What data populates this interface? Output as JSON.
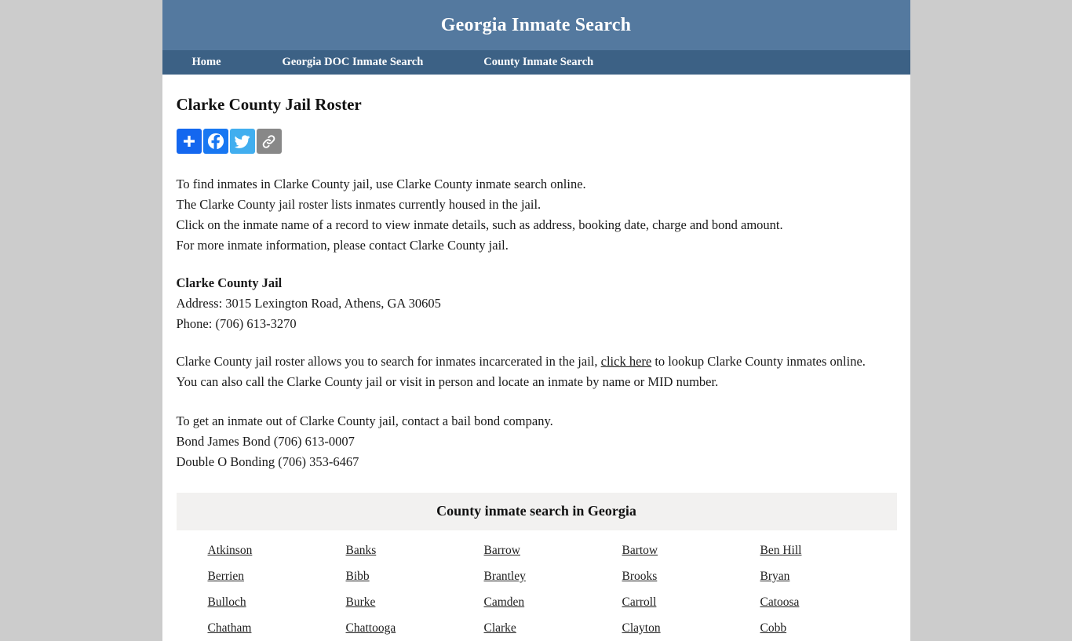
{
  "header": {
    "site_title": "Georgia Inmate Search"
  },
  "nav": {
    "items": [
      {
        "label": "Home"
      },
      {
        "label": "Georgia DOC Inmate Search"
      },
      {
        "label": "County Inmate Search"
      }
    ]
  },
  "main": {
    "page_title": "Clarke County Jail Roster",
    "share": {
      "buttons": [
        {
          "name": "share-more-button",
          "icon": "plus-icon",
          "color": "#1467ef",
          "label": "Share"
        },
        {
          "name": "share-facebook-button",
          "icon": "facebook-icon",
          "color": "#1877f2",
          "label": "Facebook"
        },
        {
          "name": "share-twitter-button",
          "icon": "twitter-icon",
          "color": "#41aeef",
          "label": "Twitter"
        },
        {
          "name": "share-copylink-button",
          "icon": "link-icon",
          "color": "#888888",
          "label": "Copy Link"
        }
      ]
    },
    "intro_lines": [
      "To find inmates in Clarke County jail, use Clarke County inmate search online.",
      "The Clarke County jail roster lists inmates currently housed in the jail.",
      "Click on the inmate name of a record to view inmate details, such as address, booking date, charge and bond amount.",
      "For more inmate information, please contact Clarke County jail."
    ],
    "jail_info": {
      "name": "Clarke County Jail",
      "address": "Address: 3015 Lexington Road, Athens, GA 30605",
      "phone": "Phone: (706) 613-3270"
    },
    "roster_paragraph": {
      "before_link": "Clarke County jail roster allows you to search for inmates incarcerated in the jail, ",
      "link_text": "click here",
      "after_link": " to lookup Clarke County inmates online. You can also call the Clarke County jail or visit in person and locate an inmate by name or MID number."
    },
    "bail_lines": [
      "To get an inmate out of Clarke County jail, contact a bail bond company.",
      "Bond James Bond (706) 613-0007",
      "Double O Bonding (706) 353-6467"
    ],
    "county_table": {
      "heading": "County inmate search in Georgia",
      "rows": [
        [
          "Atkinson",
          "Banks",
          "Barrow",
          "Bartow",
          "Ben Hill"
        ],
        [
          "Berrien",
          "Bibb",
          "Brantley",
          "Brooks",
          "Bryan"
        ],
        [
          "Bulloch",
          "Burke",
          "Camden",
          "Carroll",
          "Catoosa"
        ],
        [
          "Chatham",
          "Chattooga",
          "Clarke",
          "Clayton",
          "Cobb"
        ]
      ]
    }
  },
  "colors": {
    "page_background": "#cccccc",
    "header_blue": "#54799f",
    "nav_blue": "#3c6185",
    "content_white": "#ffffff",
    "table_header_gray": "#f2f1f0",
    "text_dark": "#1a1a1a"
  }
}
